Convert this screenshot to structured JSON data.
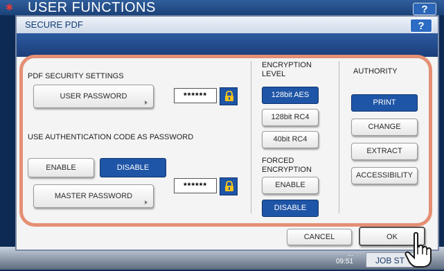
{
  "background": {
    "header_title": "USER FUNCTIONS",
    "help_label": "?",
    "time_line1": "...",
    "time_line2": "09:51",
    "job_status_label": "JOB ST"
  },
  "dialog": {
    "title": "SECURE PDF",
    "help_label": "?"
  },
  "pdf_security": {
    "heading": "PDF SECURITY SETTINGS",
    "user_password_label": "USER PASSWORD",
    "user_password_value": "******",
    "auth_code_heading": "USE AUTHENTICATION CODE AS PASSWORD",
    "enable_label": "ENABLE",
    "disable_label": "DISABLE",
    "master_password_label": "MASTER PASSWORD",
    "master_password_value": "******"
  },
  "encryption": {
    "heading_line1": "ENCRYPTION",
    "heading_line2": "LEVEL",
    "options": [
      "128bit AES",
      "128bit RC4",
      "40bit RC4"
    ],
    "selected": "128bit AES",
    "forced_heading_line1": "FORCED",
    "forced_heading_line2": "ENCRYPTION",
    "forced_enable_label": "ENABLE",
    "forced_disable_label": "DISABLE",
    "forced_selected": "DISABLE"
  },
  "authority": {
    "heading": "AUTHORITY",
    "options": [
      "PRINT",
      "CHANGE",
      "EXTRACT",
      "ACCESSIBILITY"
    ],
    "selected": [
      "PRINT"
    ]
  },
  "footer": {
    "cancel_label": "CANCEL",
    "ok_label": "OK"
  },
  "colors": {
    "accent_blue": "#1f55a6",
    "panel_border": "#e58f73"
  },
  "icons": [
    "lock-icon",
    "hand-pointer-icon",
    "help-icon"
  ]
}
